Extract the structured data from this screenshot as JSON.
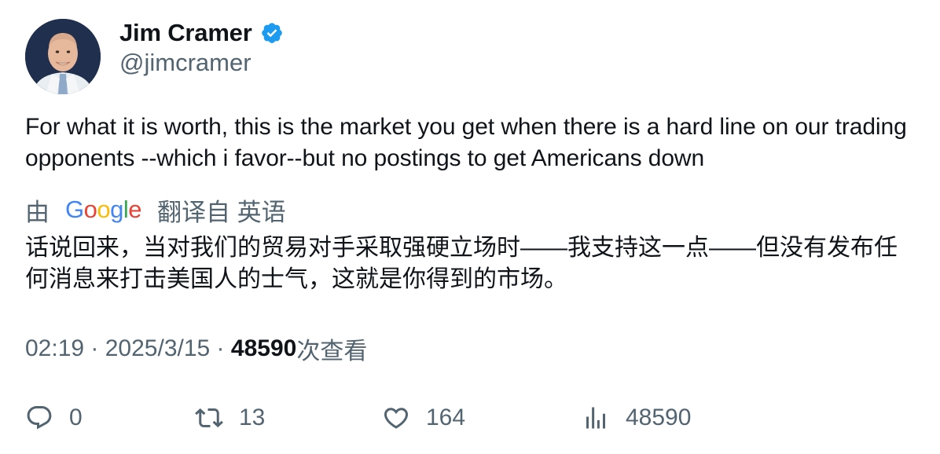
{
  "author": {
    "display_name": "Jim Cramer",
    "handle": "@jimcramer",
    "verified": true,
    "avatar_icon": "profile-photo"
  },
  "tweet": {
    "text": "For what it is worth, this is the market you get when there is a hard line on our trading opponents --which i favor--but no postings to get Americans down"
  },
  "translation": {
    "prefix": "由",
    "provider": "Google",
    "suffix": "翻译自 英语",
    "text": "话说回来，当对我们的贸易对手采取强硬立场时——我支持这一点——但没有发布任何消息来打击美国人的士气，这就是你得到的市场。"
  },
  "meta": {
    "time": "02:19",
    "separator": " · ",
    "date": "2025/3/15",
    "views_count": "48590",
    "views_label": "次查看"
  },
  "actions": {
    "replies": "0",
    "reposts": "13",
    "likes": "164",
    "views": "48590"
  },
  "colors": {
    "text_primary": "#0f1419",
    "text_secondary": "#536471",
    "verified_badge": "#1d9bf0"
  }
}
